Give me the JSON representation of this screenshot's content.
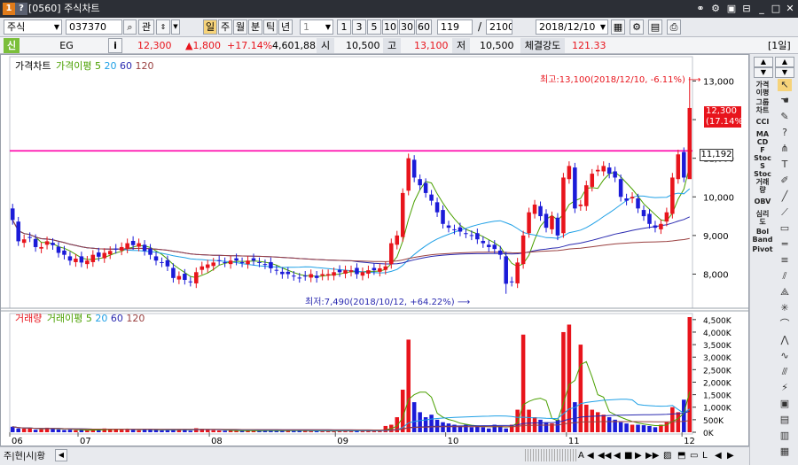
{
  "window": {
    "code": "[0560]",
    "title": "주식차트"
  },
  "toolbar": {
    "market": "주식",
    "code": "037370",
    "btn_search": "관",
    "periods": [
      "주",
      "월",
      "분",
      "틱",
      "년"
    ],
    "active_period": "일",
    "interval_value": "1",
    "interval_buttons": [
      "1",
      "3",
      "5",
      "10",
      "30",
      "60"
    ],
    "count": "119",
    "total": "2100",
    "date": "2018/12/10"
  },
  "quote": {
    "tag": "신",
    "name": "EG",
    "info": "i",
    "price": "12,300",
    "change": "▲1,800",
    "rate": "+17.14%",
    "volume": "4,601,883",
    "open_label": "시",
    "open": "10,500",
    "high_label": "고",
    "high": "13,100",
    "low_label": "저",
    "low": "10,500",
    "strength_label": "체결강도",
    "strength": "121.33",
    "period_tag": "[1일]"
  },
  "price_legend": {
    "title": "가격차트",
    "ma_label": "가격이평",
    "ma": [
      "5",
      "20",
      "60",
      "120"
    ]
  },
  "volume_legend": {
    "title": "거래량",
    "ma_label": "거래이평",
    "ma": [
      "5",
      "20",
      "60",
      "120"
    ]
  },
  "annotations": {
    "high_note": "최고:13,100(2018/12/10, -6.11%)",
    "low_note": "최저:7,490(2018/10/12, +64.22%)",
    "last_price": "12,300",
    "last_rate": "(17.14%)",
    "hline_label": "11,192"
  },
  "colors": {
    "up": "#e8141c",
    "down": "#1b1bd8",
    "ma5": "#4aa000",
    "ma20": "#1fa0e6",
    "ma60": "#2a2ab0",
    "ma120": "#9a4040",
    "hline": "#ff00a8"
  },
  "chart_data": [
    {
      "type": "candlestick",
      "yticks": [
        "13,000",
        "12,000",
        "11,000",
        "10,000",
        "9,000",
        "8,000"
      ],
      "ylim": [
        7300,
        13400
      ],
      "x_months": [
        "06",
        "07",
        "08",
        "09",
        "10",
        "11",
        "12"
      ],
      "highest": {
        "value": 13100,
        "date": "2018/12/10"
      },
      "lowest": {
        "value": 7490,
        "date": "2018/10/12"
      },
      "horizontal_line": 11192,
      "closes": [
        9400,
        8850,
        8900,
        8950,
        8700,
        8700,
        8850,
        8750,
        8550,
        8500,
        8350,
        8400,
        8300,
        8350,
        8500,
        8450,
        8550,
        8600,
        8650,
        8700,
        8800,
        8750,
        8800,
        8600,
        8500,
        8350,
        8300,
        8200,
        7900,
        7950,
        7850,
        7800,
        8050,
        8200,
        8250,
        8300,
        8350,
        8300,
        8350,
        8350,
        8300,
        8350,
        8350,
        8300,
        8250,
        8150,
        8100,
        8000,
        8000,
        7950,
        7900,
        7950,
        8000,
        7900,
        8000,
        8000,
        8050,
        8050,
        8100,
        8100,
        8000,
        8050,
        8100,
        8100,
        8150,
        8200,
        8800,
        9000,
        10100,
        11000,
        10500,
        10300,
        10100,
        9900,
        9600,
        9300,
        9200,
        9150,
        9100,
        9050,
        9000,
        8900,
        8800,
        8700,
        8650,
        8500,
        7750,
        7800,
        8300,
        9000,
        9600,
        9800,
        9500,
        9200,
        9500,
        9000,
        10500,
        10800,
        9700,
        9800,
        10300,
        10600,
        10700,
        10800,
        10600,
        10500,
        10000,
        9900,
        10000,
        9700,
        9500,
        9300,
        9200,
        9300,
        9600,
        10500,
        11100,
        10500,
        12300
      ],
      "ma_series": [
        "5",
        "20",
        "60",
        "120"
      ]
    },
    {
      "type": "bar",
      "yticks": [
        "4,500K",
        "4,000K",
        "3,500K",
        "3,000K",
        "2,500K",
        "2,000K",
        "1,500K",
        "1,000K",
        "500K",
        "0K"
      ],
      "ylim": [
        0,
        4600000
      ],
      "volumes": [
        220000,
        150000,
        140000,
        160000,
        100000,
        120000,
        180000,
        150000,
        110000,
        90000,
        100000,
        80000,
        90000,
        70000,
        120000,
        80000,
        150000,
        130000,
        110000,
        100000,
        140000,
        90000,
        80000,
        120000,
        100000,
        90000,
        70000,
        80000,
        120000,
        110000,
        90000,
        60000,
        160000,
        140000,
        100000,
        80000,
        70000,
        60000,
        70000,
        50000,
        60000,
        70000,
        60000,
        50000,
        70000,
        60000,
        50000,
        80000,
        60000,
        50000,
        70000,
        60000,
        50000,
        40000,
        50000,
        60000,
        50000,
        70000,
        60000,
        50000,
        80000,
        60000,
        70000,
        50000,
        60000,
        250000,
        300000,
        600000,
        1700000,
        3700000,
        1200000,
        800000,
        600000,
        700000,
        500000,
        400000,
        350000,
        300000,
        250000,
        300000,
        200000,
        250000,
        200000,
        150000,
        300000,
        250000,
        150000,
        300000,
        900000,
        3900000,
        900000,
        600000,
        500000,
        400000,
        350000,
        500000,
        4000000,
        4300000,
        1200000,
        3500000,
        1100000,
        900000,
        800000,
        700000,
        600000,
        500000,
        400000,
        350000,
        300000,
        300000,
        280000,
        250000,
        200000,
        300000,
        400000,
        1000000,
        800000,
        1300000,
        4600000
      ]
    }
  ],
  "bottom": {
    "tabs": "주|현|시|황"
  }
}
